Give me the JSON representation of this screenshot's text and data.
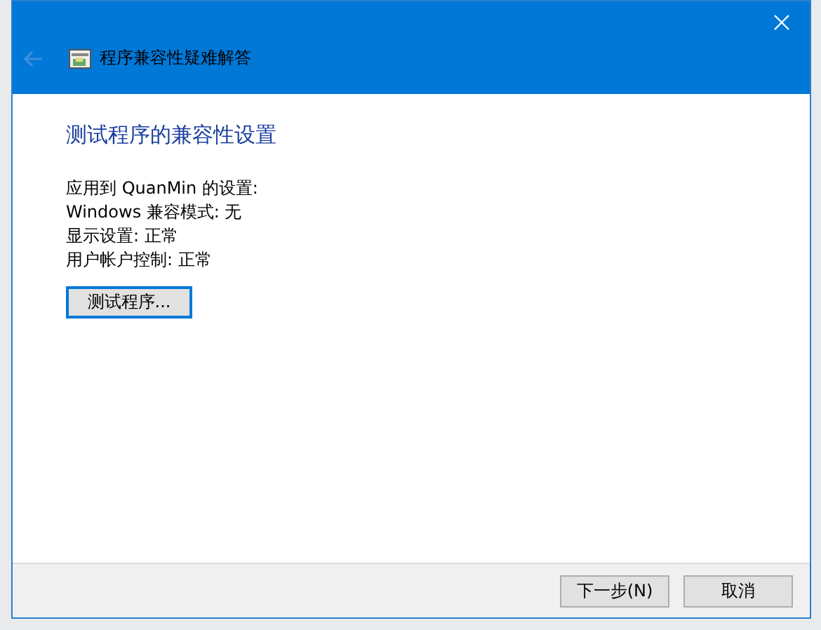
{
  "window": {
    "title": "程序兼容性疑难解答"
  },
  "heading": "测试程序的兼容性设置",
  "settings": [
    "应用到  QuanMin 的设置:",
    "Windows 兼容模式: 无",
    "显示设置:  正常",
    "用户帐户控制:  正常"
  ],
  "test_button": "测试程序...",
  "buttons": [
    {
      "label": "下一步(N)",
      "disabled": false
    },
    {
      "label": "取消",
      "disabled": false
    }
  ]
}
